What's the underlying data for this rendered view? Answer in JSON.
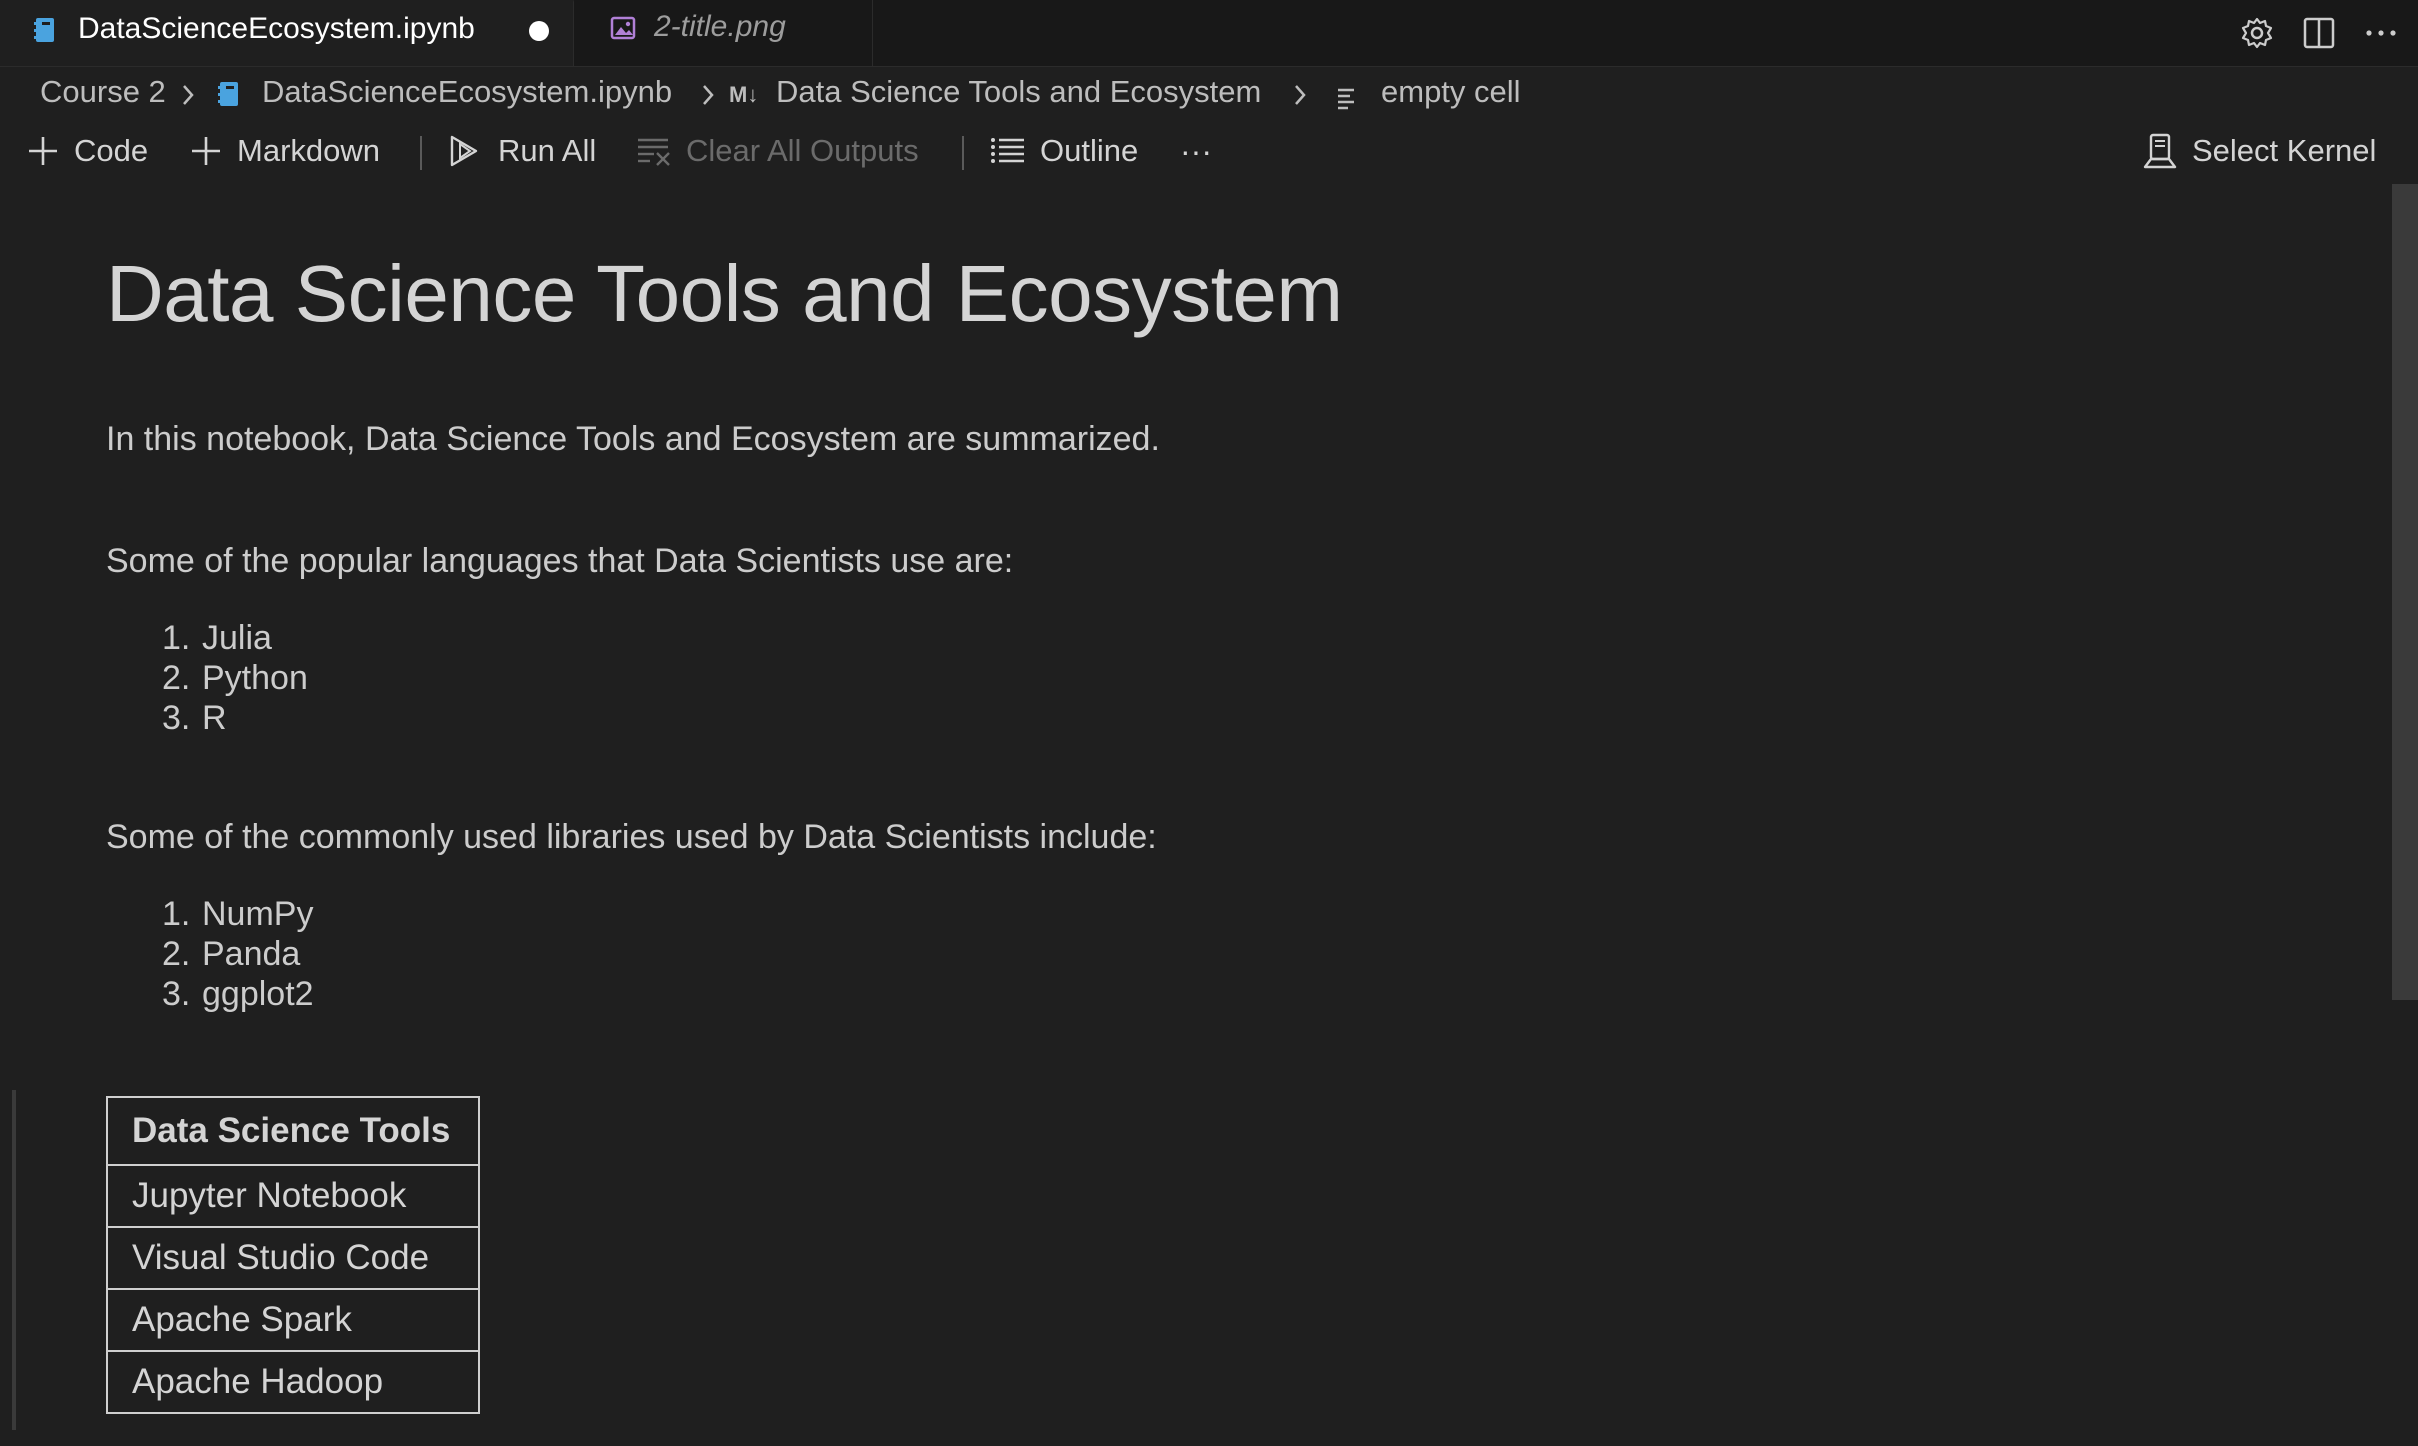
{
  "tabs": [
    {
      "label": "DataScienceEcosystem.ipynb",
      "icon": "notebook-icon",
      "active": true,
      "dirty": true
    },
    {
      "label": "2-title.png",
      "icon": "image-icon",
      "active": false
    }
  ],
  "breadcrumb": {
    "items": [
      "Course 2",
      "DataScienceEcosystem.ipynb",
      "Data Science Tools and Ecosystem",
      "empty cell"
    ],
    "md_badge": "M↓"
  },
  "toolbar": {
    "code": "Code",
    "markdown": "Markdown",
    "run_all": "Run All",
    "clear_all_outputs": "Clear All Outputs",
    "outline": "Outline",
    "more": "···",
    "select_kernel": "Select Kernel"
  },
  "notebook": {
    "title": "Data Science Tools and Ecosystem",
    "intro": "In this notebook, Data Science Tools and Ecosystem are summarized.",
    "languages_heading": "Some of the popular languages that Data Scientists use are:",
    "languages": [
      "Julia",
      "Python",
      "R"
    ],
    "libraries_heading": "Some of the commonly used libraries used by Data Scientists include:",
    "libraries": [
      "NumPy",
      "Panda",
      "ggplot2"
    ],
    "tools_table": {
      "header": "Data Science Tools",
      "rows": [
        "Jupyter Notebook",
        "Visual Studio Code",
        "Apache Spark",
        "Apache Hadoop"
      ]
    }
  },
  "colors": {
    "background": "#1f1f1f",
    "tabbar": "#181818",
    "notebook_icon": "#4aa3df",
    "image_icon": "#b180d7"
  }
}
